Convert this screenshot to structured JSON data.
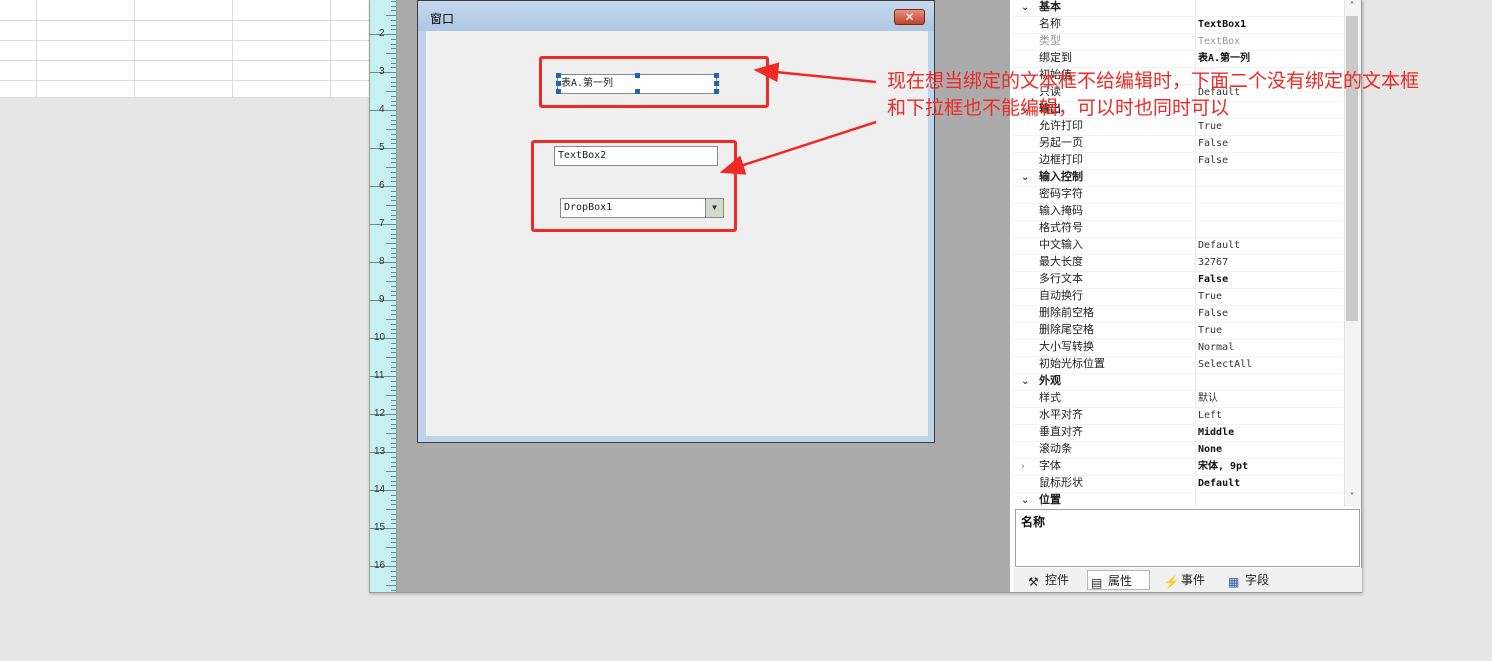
{
  "form": {
    "title": "窗口",
    "textbox1_value": "表A.第一列",
    "textbox2_value": "TextBox2",
    "dropbox1_value": "DropBox1"
  },
  "ruler": {
    "marks": [
      "2",
      "3",
      "4",
      "5",
      "6",
      "7",
      "8",
      "9",
      "10",
      "11",
      "12",
      "13",
      "14",
      "15",
      "16"
    ]
  },
  "properties": {
    "rows": [
      {
        "type": "cat",
        "name": "基本"
      },
      {
        "type": "prop",
        "name": "名称",
        "value": "TextBox1",
        "bold": true
      },
      {
        "type": "prop",
        "name": "类型",
        "value": "TextBox",
        "gray": true
      },
      {
        "type": "prop",
        "name": "绑定到",
        "value": "表A.第一列",
        "bold": true
      },
      {
        "type": "prop",
        "name": "初始值",
        "value": ""
      },
      {
        "type": "prop",
        "name": "只读",
        "value": "Default"
      },
      {
        "type": "cat",
        "name": "输出"
      },
      {
        "type": "prop",
        "name": "允许打印",
        "value": "True"
      },
      {
        "type": "prop",
        "name": "另起一页",
        "value": "False"
      },
      {
        "type": "prop",
        "name": "边框打印",
        "value": "False"
      },
      {
        "type": "cat",
        "name": "输入控制"
      },
      {
        "type": "prop",
        "name": "密码字符",
        "value": ""
      },
      {
        "type": "prop",
        "name": "输入掩码",
        "value": ""
      },
      {
        "type": "prop",
        "name": "格式符号",
        "value": ""
      },
      {
        "type": "prop",
        "name": "中文输入",
        "value": "Default"
      },
      {
        "type": "prop",
        "name": "最大长度",
        "value": "32767"
      },
      {
        "type": "prop",
        "name": "多行文本",
        "value": "False",
        "bold": true
      },
      {
        "type": "prop",
        "name": "自动换行",
        "value": "True"
      },
      {
        "type": "prop",
        "name": "删除前空格",
        "value": "False"
      },
      {
        "type": "prop",
        "name": "删除尾空格",
        "value": "True"
      },
      {
        "type": "prop",
        "name": "大小写转换",
        "value": "Normal"
      },
      {
        "type": "prop",
        "name": "初始光标位置",
        "value": "SelectAll"
      },
      {
        "type": "cat",
        "name": "外观"
      },
      {
        "type": "prop",
        "name": "样式",
        "value": "默认"
      },
      {
        "type": "prop",
        "name": "水平对齐",
        "value": "Left"
      },
      {
        "type": "prop",
        "name": "垂直对齐",
        "value": "Middle",
        "bold": true
      },
      {
        "type": "prop",
        "name": "滚动条",
        "value": "None",
        "bold": true
      },
      {
        "type": "prop",
        "name": "字体",
        "value": "宋体, 9pt",
        "bold": true,
        "collapsed": true
      },
      {
        "type": "prop",
        "name": "鼠标形状",
        "value": "Default",
        "bold": true
      },
      {
        "type": "cat",
        "name": "位置"
      }
    ],
    "description_title": "名称"
  },
  "tabs": [
    {
      "label": "控件",
      "icon": "tools-icon",
      "glyph": "⚒"
    },
    {
      "label": "属性",
      "icon": "properties-icon",
      "glyph": "▤"
    },
    {
      "label": "事件",
      "icon": "lightning-icon",
      "glyph": "⚡"
    },
    {
      "label": "字段",
      "icon": "fields-icon",
      "glyph": "▦"
    }
  ],
  "annotation": {
    "line1": "现在想当绑定的文本框不给编辑时，下面二个没有绑定的文本框",
    "line2": "和下拉框也不能编辑，可以时也同时可以"
  },
  "colors": {
    "annotation_red": "#ee2a25",
    "ruler": "#c7f0f0",
    "canvas": "#ababab"
  }
}
